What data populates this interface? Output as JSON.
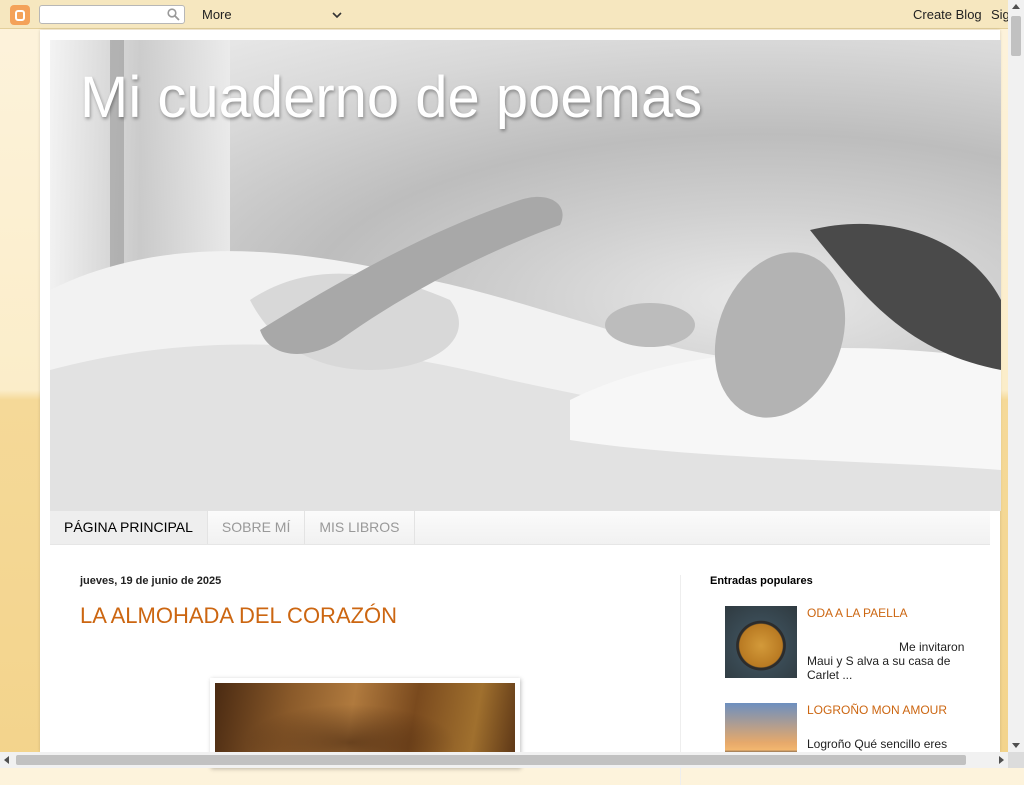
{
  "navbar": {
    "more_label": "More",
    "create_blog_label": "Create Blog",
    "sign_in_label": "Sig"
  },
  "header": {
    "blog_title": "Mi cuaderno de poemas"
  },
  "tabs": [
    {
      "label": "PÁGINA PRINCIPAL",
      "active": true
    },
    {
      "label": "SOBRE MÍ",
      "active": false
    },
    {
      "label": "MIS LIBROS",
      "active": false
    }
  ],
  "post": {
    "date": "jueves, 19 de junio de 2025",
    "title": "LA ALMOHADA DEL CORAZÓN"
  },
  "sidebar": {
    "popular_title": "Entradas populares",
    "popular_posts": [
      {
        "title": "ODA A LA PAELLA",
        "snippet": "Me invitaron Maui y S alva a su casa de Carlet ..."
      },
      {
        "title": "LOGROÑO MON AMOUR",
        "snippet": "Logroño Qué sencillo eres Qué ... Qué"
      }
    ]
  },
  "colors": {
    "accent": "#cc6611",
    "navbar_bg": "#f6e7bf",
    "page_bg": "#f3d48c"
  }
}
